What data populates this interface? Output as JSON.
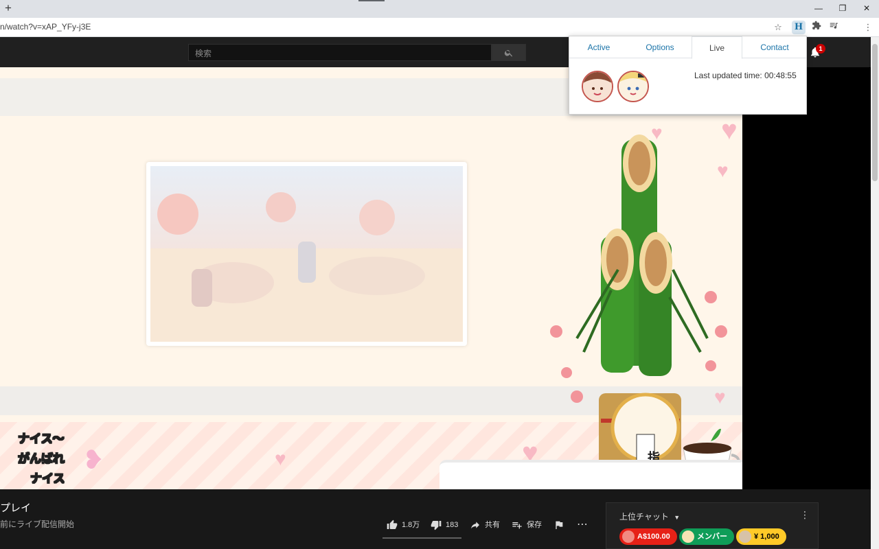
{
  "browser": {
    "new_tab_label": "+",
    "url": "n/watch?v=xAP_YFy-j3E",
    "window_controls": [
      "—",
      "❐",
      "✕"
    ]
  },
  "youtube": {
    "search_placeholder": "検索",
    "notification_count": "1"
  },
  "popup": {
    "tabs": [
      {
        "label": "Active"
      },
      {
        "label": "Options"
      },
      {
        "label": "Live"
      },
      {
        "label": "Contact"
      }
    ],
    "active_tab": "Live",
    "last_updated": "Last updated time: 00:48:55"
  },
  "stream_overlay": {
    "comments": [
      "ナイス〜",
      "がんばれ",
      "ナイス"
    ],
    "sign_text": "指"
  },
  "video_info": {
    "title": "プレイ",
    "subtitle": "前にライブ配信開始",
    "likes": "1.8万",
    "dislikes": "183",
    "share_label": "共有",
    "save_label": "保存"
  },
  "chat": {
    "title": "上位チャット",
    "chips": [
      {
        "label": "A$100.00",
        "bg": "#e62117",
        "fg": "#ffffff"
      },
      {
        "label": "メンバー",
        "bg": "#0f9d58",
        "fg": "#ffffff"
      },
      {
        "label": "¥ 1,000",
        "bg": "#ffca28",
        "fg": "#000000"
      }
    ]
  },
  "colors": {
    "accent_link": "#1a73a8",
    "yt_bg": "#181818"
  }
}
